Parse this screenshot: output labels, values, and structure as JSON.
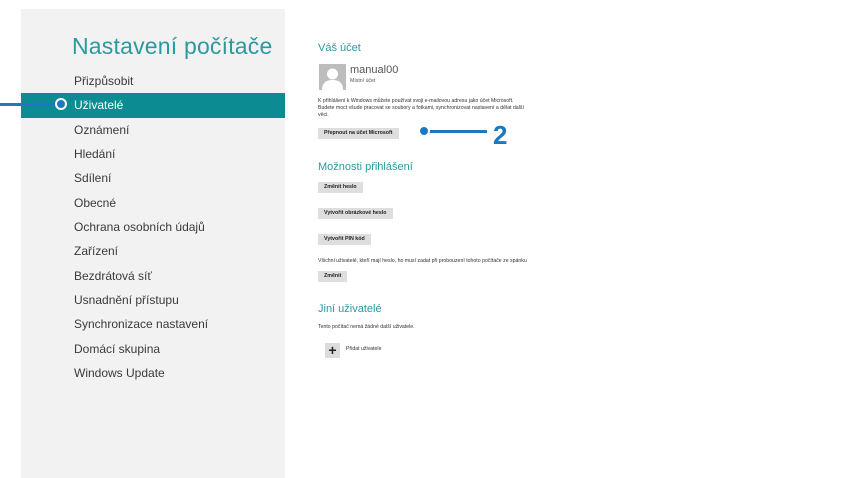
{
  "sidebar": {
    "title": "Nastavení počítače",
    "items": [
      {
        "label": "Přizpůsobit"
      },
      {
        "label": "Uživatelé"
      },
      {
        "label": "Oznámení"
      },
      {
        "label": "Hledání"
      },
      {
        "label": "Sdílení"
      },
      {
        "label": "Obecné"
      },
      {
        "label": "Ochrana osobních údajů"
      },
      {
        "label": "Zařízení"
      },
      {
        "label": "Bezdrátová síť"
      },
      {
        "label": "Usnadnění přístupu"
      },
      {
        "label": "Synchronizace nastavení"
      },
      {
        "label": "Domácí skupina"
      },
      {
        "label": "Windows Update"
      }
    ],
    "active_index": 1
  },
  "account": {
    "heading": "Váš účet",
    "username": "manual00",
    "account_type": "Místní účet",
    "description_lines": [
      "K přihlášení k Windows můžete používat svoji e-mailovou adresu jako účet Microsoft.",
      "Budete moct všude pracovat se soubory a fotkami, synchronizovat nastavení a dělat další",
      "věci."
    ],
    "switch_button": "Přepnout na účet Microsoft"
  },
  "signin": {
    "heading": "Možnosti přihlášení",
    "change_password": "Změnit heslo",
    "picture_password": "Vytvořit obrázkové heslo",
    "create_pin": "Vytvořit PIN kód",
    "wake_text": "Všichni uživatelé, kteří mají heslo, ho musí zadat při probouzení tohoto počítače ze spánku",
    "change_button": "Změnit"
  },
  "others": {
    "heading": "Jiní uživatelé",
    "none_text": "Tento počítač nemá žádné další uživatele.",
    "add_user": "Přidat uživatele"
  },
  "callout": {
    "number": "2",
    "color": "#1c79c0"
  },
  "colors": {
    "accent": "#2a9a9f",
    "selection": "#0d8b93",
    "sidebar_bg": "#f2f2f2"
  }
}
